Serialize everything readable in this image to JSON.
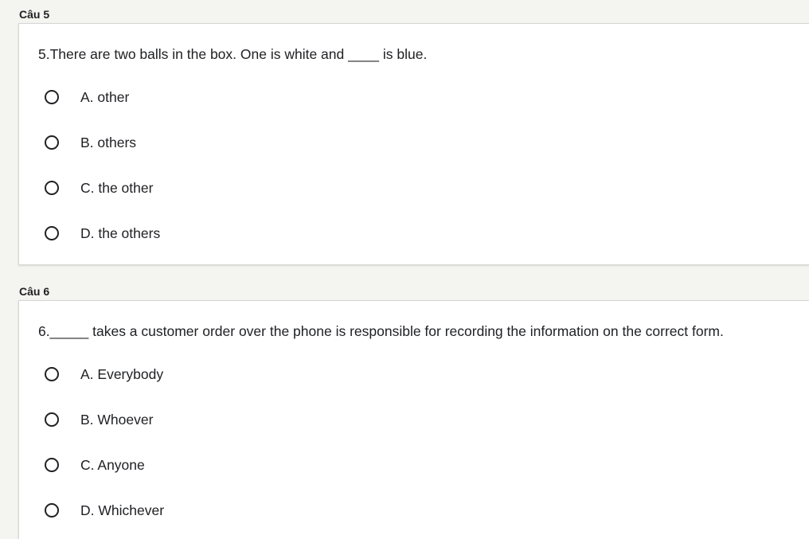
{
  "questions": [
    {
      "label": "Câu 5",
      "text": "5.There are two balls in the box. One is white and ____ is blue.",
      "options": [
        {
          "label": "A. other"
        },
        {
          "label": "B. others"
        },
        {
          "label": "C. the other"
        },
        {
          "label": "D. the others"
        }
      ]
    },
    {
      "label": "Câu 6",
      "text": "6._____ takes a customer order over the phone is responsible for recording the information on the correct form.",
      "options": [
        {
          "label": "A. Everybody"
        },
        {
          "label": "B. Whoever"
        },
        {
          "label": "C. Anyone"
        },
        {
          "label": "D. Whichever"
        }
      ]
    }
  ]
}
